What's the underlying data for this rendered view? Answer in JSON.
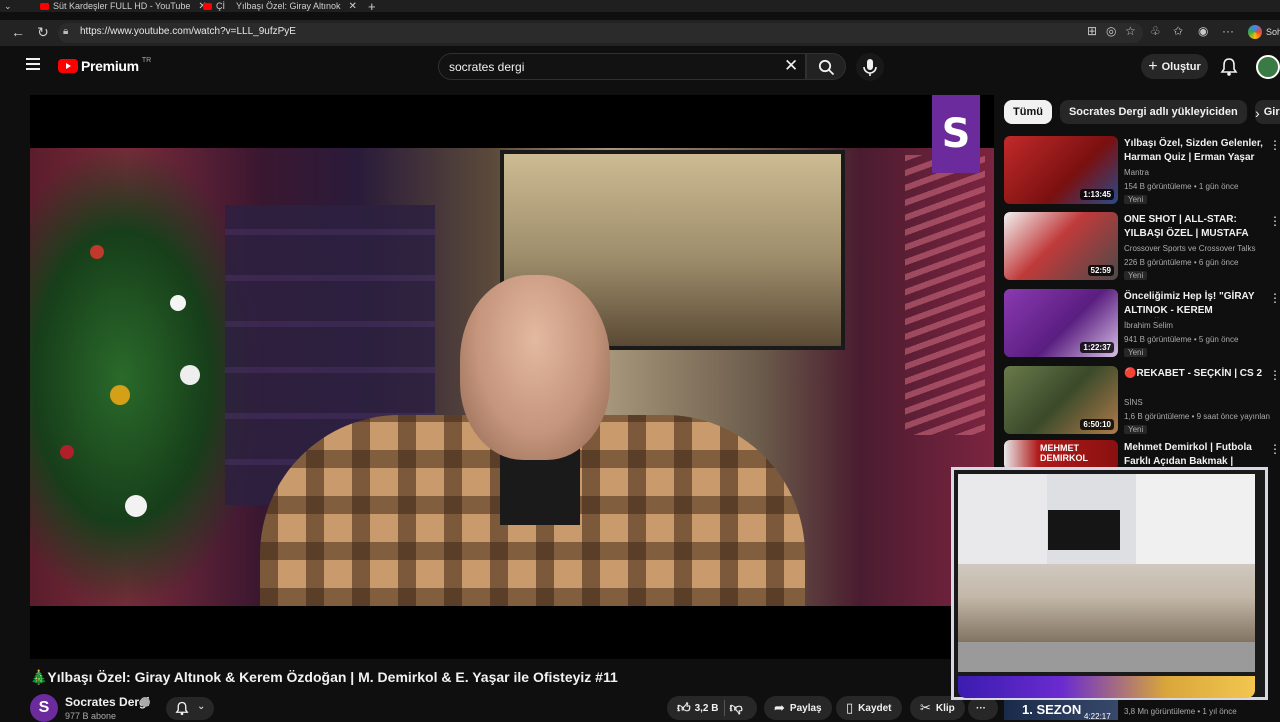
{
  "browser": {
    "tabs": [
      {
        "label": "Süt Kardeşler FULL HD - YouTube"
      },
      {
        "label": "Çİ"
      },
      {
        "label": "Yılbaşı Özel: Giray Altınok"
      }
    ],
    "url": "https://www.youtube.com/watch?v=LLL_9ufzPyE",
    "profile_label": "Soh"
  },
  "header": {
    "logo_word": "Premium",
    "logo_tr": "TR",
    "search_value": "socrates dergi",
    "create_label": "Oluştur"
  },
  "video": {
    "channel_logo_letter": "S",
    "title": "🎄Yılbaşı Özel: Giray Altınok & Kerem Özdoğan | M. Demirkol & E. Yaşar ile Ofisteyiz #11",
    "channel_avatar_letter": "S",
    "channel_name": "Socrates Dergi",
    "subscribers": "977 B abone",
    "likes": "3,2 B",
    "share_label": "Paylaş",
    "save_label": "Kaydet",
    "clip_label": "Klip",
    "more_label": "···"
  },
  "chips": [
    {
      "label": "Tümü",
      "active": true
    },
    {
      "label": "Socrates Dergi adlı yükleyiciden",
      "active": false
    },
    {
      "label": "Giray",
      "active": false
    }
  ],
  "recommendations": [
    {
      "title": "Yılbaşı Özel, Sizden Gelenler, Harman Quiz | Erman Yaşar & ...",
      "channel": "Mantra",
      "meta": "154 B görüntüleme • 1 gün önce",
      "badge": "Yeni",
      "duration": "1:13:45",
      "thumb_color": "#8a1e1e"
    },
    {
      "title": "ONE SHOT | ALL-STAR: YILBAŞI ÖZEL | MUSTAFA DEMİRTAŞ, ...",
      "channel": "Crossover Sports ve Crossover Talks",
      "meta": "226 B görüntüleme • 6 gün önce",
      "badge": "Yeni",
      "duration": "52:59",
      "thumb_color": "#c03a3a"
    },
    {
      "title": "Önceliğimiz Hep İş! \"GİRAY ALTINOK - KEREM ÖZDOĞAN\" ...",
      "channel": "İbrahim Selim",
      "meta": "941 B görüntüleme • 5 gün önce",
      "badge": "Yeni",
      "duration": "1:22:37",
      "thumb_color": "#7a2ea0"
    },
    {
      "title": "🔴REKABET - SEÇKİN | CS 2",
      "channel": "SİNS",
      "meta": "1,6 B görüntüleme • 9 saat önce yayınlan",
      "badge": "Yeni",
      "duration": "6:50:10",
      "thumb_color": "#5a6a3a"
    },
    {
      "title": "Mehmet Demirkol | Futbola Farklı Açıdan Bakmak | Kimsin...",
      "channel": "",
      "meta": "",
      "badge": "",
      "duration": "",
      "thumb_color": "#a01a1a",
      "thumb_text": "MEHMET DEMIRKOL"
    }
  ],
  "bottom_rec": {
    "thumb_text": "1. SEZON",
    "duration": "4:22:17",
    "meta": "3,8 Mn görüntüleme • 1 yıl önce"
  }
}
